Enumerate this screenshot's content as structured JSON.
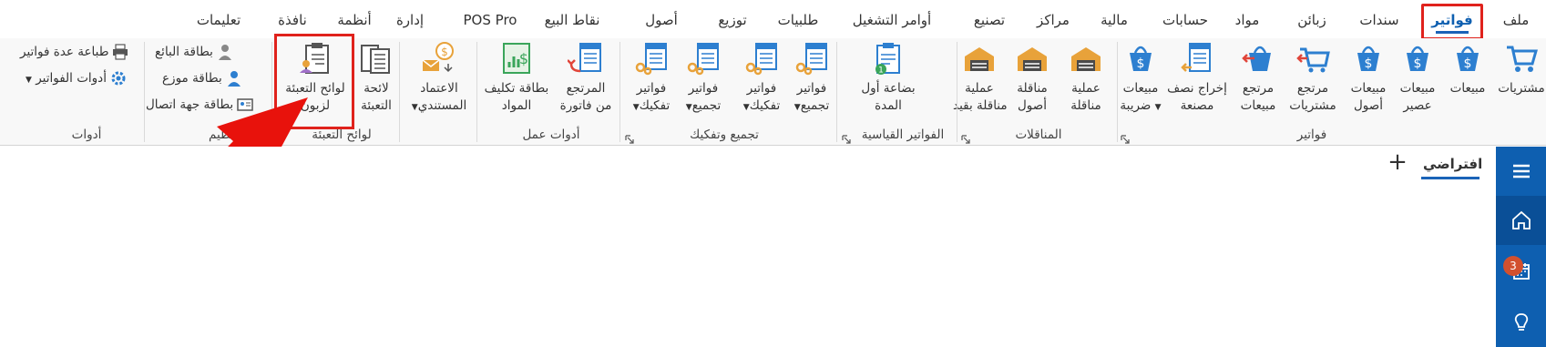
{
  "menu": {
    "tabs": [
      "ملف",
      "فواتير",
      "سندات",
      "زبائن",
      "مواد",
      "حسابات",
      "مالية",
      "مراكز",
      "تصنيع",
      "أوامر التشغيل",
      "طلبيات",
      "توزيع",
      "أصول",
      "نقاط البيع",
      "POS Pro",
      "إدارة",
      "أنظمة",
      "نافذة",
      "تعليمات"
    ],
    "active": "فواتير"
  },
  "ribbon": {
    "groups": {
      "invoices": "فواتير",
      "transfers": "المناقلات",
      "standard": "الفواتير القياسية",
      "assembly": "تجميع وتفكيك",
      "work_tools": "أدوات عمل",
      "packing": "لوائح التعبئة",
      "organize": "تنظيم",
      "tools": "أدوات"
    },
    "buttons": {
      "purchases": "مشتريات",
      "sales": "مبيعات",
      "sales_juice_1": "مبيعات",
      "sales_juice_2": "عصير",
      "sales_assets_1": "مبيعات",
      "sales_assets_2": "أصول",
      "ret_purchases_1": "مرتجع",
      "ret_purchases_2": "مشتريات",
      "ret_sales_1": "مرتجع",
      "ret_sales_2": "مبيعات",
      "semi_out_1": "إخراج نصف",
      "semi_out_2": "مصنعة",
      "tax_sales_1": "مبيعات",
      "tax_sales_2": "ضريبة",
      "transfer_op_1": "عملية",
      "transfer_op_2": "مناقلة",
      "asset_transfer_1": "مناقلة",
      "asset_transfer_2": "أصول",
      "restricted_transfer_1": "عملية",
      "restricted_transfer_2": "مناقلة بقيد",
      "opening_goods_1": "بضاعة أول",
      "opening_goods_2": "المدة",
      "assembly_inv_1_a": "فواتير",
      "assembly_inv_1_b": "تجميع",
      "disassembly_inv_1_a": "فواتير",
      "disassembly_inv_1_b": "تفكيك",
      "assembly_inv_2_a": "فواتير",
      "assembly_inv_2_b": "تجميع",
      "disassembly_inv_2_a": "فواتير",
      "disassembly_inv_2_b": "تفكيك",
      "returned_from_invoice_1": "المرتجع",
      "returned_from_invoice_2": "من فاتورة",
      "material_cost_card_1": "بطاقة تكليف",
      "material_cost_card_2": "المواد",
      "approval_1": "الاعتماد",
      "approval_2": "المستندي",
      "packing_list_1": "لائحة",
      "packing_list_2": "التعبئة",
      "customer_packing_1": "لوائح التعبئة",
      "customer_packing_2": "لزبون"
    },
    "small": {
      "seller_card": "بطاقة البائع",
      "distributor_card": "بطاقة موزع",
      "contact_card": "بطاقة جهة اتصال",
      "print_multiple": "طباعة عدة فواتير",
      "invoice_tools": "أدوات الفواتير"
    }
  },
  "content": {
    "view_tab": "افتراضي",
    "add_symbol": "+",
    "notification_count": "3"
  },
  "colors": {
    "accent": "#0e5fb0",
    "highlight": "#e0221c",
    "badge": "#d2502e"
  }
}
